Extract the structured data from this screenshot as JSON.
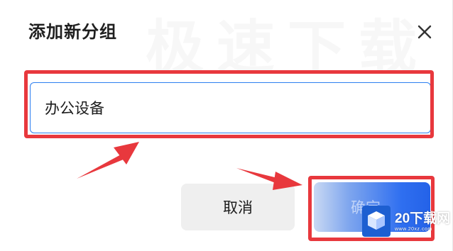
{
  "dialog": {
    "title": "添加新分组",
    "close_icon": "close-icon",
    "input": {
      "value": "办公设备"
    },
    "buttons": {
      "cancel_label": "取消",
      "confirm_label": "确定"
    }
  },
  "watermark": {
    "text": "极速下载"
  },
  "logo": {
    "text": "20下载网",
    "sub": "www.20xz.com"
  },
  "colors": {
    "annotation_red": "#e8383d",
    "primary_blue": "#2f6ff0",
    "input_focus_border": "#2d7ff0",
    "cancel_bg": "#efefef"
  }
}
